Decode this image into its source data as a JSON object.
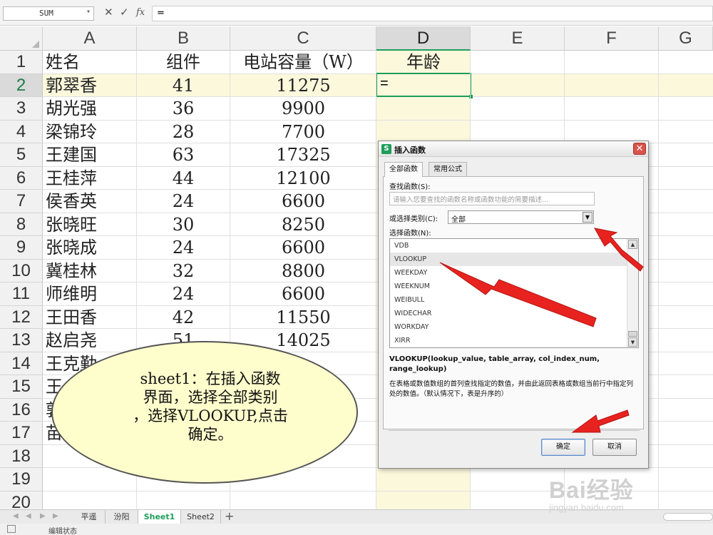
{
  "formula_bar": {
    "name_box": "SUM",
    "cancel_icon": "✕",
    "confirm_icon": "✓",
    "fx_label": "fx",
    "content": "="
  },
  "columns": [
    "A",
    "B",
    "C",
    "D",
    "E",
    "F",
    "G"
  ],
  "selected_column": "D",
  "row_numbers": [
    "1",
    "2",
    "3",
    "4",
    "5",
    "6",
    "7",
    "8",
    "9",
    "10",
    "11",
    "12",
    "13",
    "14",
    "15",
    "16",
    "17",
    "18",
    "19",
    "20"
  ],
  "header_row": {
    "a": "姓名",
    "b": "组件",
    "c": "电站容量（W）",
    "d": "年龄"
  },
  "data_rows": [
    {
      "a": "郭翠香",
      "b": "41",
      "c": "11275"
    },
    {
      "a": "胡光强",
      "b": "36",
      "c": "9900"
    },
    {
      "a": "梁锦玲",
      "b": "28",
      "c": "7700"
    },
    {
      "a": "王建国",
      "b": "63",
      "c": "17325"
    },
    {
      "a": "王桂萍",
      "b": "44",
      "c": "12100"
    },
    {
      "a": "侯香英",
      "b": "24",
      "c": "6600"
    },
    {
      "a": "张晓旺",
      "b": "30",
      "c": "8250"
    },
    {
      "a": "张晓成",
      "b": "24",
      "c": "6600"
    },
    {
      "a": "冀桂林",
      "b": "32",
      "c": "8800"
    },
    {
      "a": "师维明",
      "b": "24",
      "c": "6600"
    },
    {
      "a": "王田香",
      "b": "42",
      "c": "11550"
    },
    {
      "a": "赵启尧",
      "b": "51",
      "c": "14025"
    },
    {
      "a": "王克勤",
      "b": "",
      "c": ""
    },
    {
      "a": "王",
      "b": "",
      "c": ""
    },
    {
      "a": "郭",
      "b": "",
      "c": ""
    },
    {
      "a": "苗",
      "b": "",
      "c": ""
    }
  ],
  "active_cell": {
    "ref": "D2",
    "value": "="
  },
  "sheet_tabs": [
    "平遥",
    "汾阳",
    "Sheet1",
    "Sheet2"
  ],
  "active_sheet": "Sheet1",
  "add_sheet": "+",
  "status_text": "编辑状态",
  "dialog": {
    "logo": "S",
    "title": "插入函数",
    "close": "✕",
    "tabs": [
      "全部函数",
      "常用公式"
    ],
    "search_label": "查找函数(S):",
    "search_placeholder": "请输入您要查找的函数名称或函数功能的简要描述...",
    "category_label": "或选择类别(C):",
    "category_value": "全部",
    "list_label": "选择函数(N):",
    "functions": [
      "VDB",
      "VLOOKUP",
      "WEEKDAY",
      "WEEKNUM",
      "WEIBULL",
      "WIDECHAR",
      "WORKDAY",
      "XIRR"
    ],
    "selected_function": "VLOOKUP",
    "signature": "VLOOKUP(lookup_value, table_array, col_index_num, range_lookup)",
    "description": "在表格或数值数组的首列查找指定的数值，并由此返回表格或数组当前行中指定列处的数值。（默认情况下，表是升序的）",
    "ok": "确定",
    "cancel": "取消"
  },
  "annotation": {
    "text": "sheet1：在插入函数\n界面，选择全部类别\n，选择VLOOKUP,点击\n确定。",
    "bubble_color": "#fefdcc",
    "arrow_color": "#e8231f"
  },
  "watermark": {
    "brand": "Bai经验",
    "url": "jingyan.baidu.com"
  },
  "colors": {
    "accent_green": "#1e9e5a",
    "highlight_row": "#fbf8dc",
    "dialog_close": "#d9534a"
  }
}
